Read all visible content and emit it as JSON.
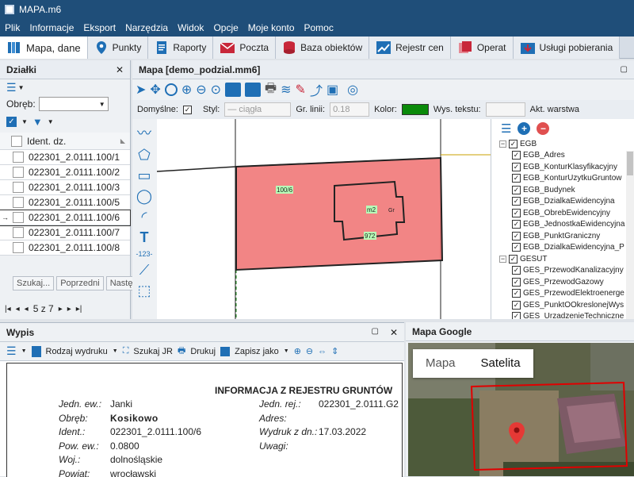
{
  "window": {
    "title": "MAPA.m6"
  },
  "menu": [
    "Plik",
    "Informacje",
    "Eksport",
    "Narzędzia",
    "Widok",
    "Opcje",
    "Moje konto",
    "Pomoc"
  ],
  "tabs": [
    {
      "label": "Mapa, dane",
      "icon": "map-book-icon",
      "color": "#1f6fb5"
    },
    {
      "label": "Punkty",
      "icon": "map-pin-icon",
      "color": "#1f6fb5"
    },
    {
      "label": "Raporty",
      "icon": "report-icon",
      "color": "#1f6fb5"
    },
    {
      "label": "Poczta",
      "icon": "envelope-icon",
      "color": "#c8273a"
    },
    {
      "label": "Baza obiektów",
      "icon": "database-icon",
      "color": "#c8273a"
    },
    {
      "label": "Rejestr cen",
      "icon": "chart-icon",
      "color": "#1f6fb5"
    },
    {
      "label": "Operat",
      "icon": "folders-icon",
      "color": "#c8273a"
    },
    {
      "label": "Usługi pobierania",
      "icon": "download-folder-icon",
      "color": "#1f6fb5"
    }
  ],
  "left": {
    "title": "Działki",
    "obreb_label": "Obręb:",
    "obreb_value": "",
    "column": "Ident. dz.",
    "rows": [
      "022301_2.0111.100/1",
      "022301_2.0111.100/2",
      "022301_2.0111.100/3",
      "022301_2.0111.100/5",
      "022301_2.0111.100/6",
      "022301_2.0111.100/7",
      "022301_2.0111.100/8"
    ],
    "selected_index": 4,
    "buttons": [
      "Szukaj...",
      "Poprzedni",
      "Następ"
    ],
    "pager": "5 z 7"
  },
  "map": {
    "title": "Mapa [demo_podzial.mm6]",
    "domyslne": "Domyślne:",
    "styl": "Styl:",
    "styl_value": "— ciągła",
    "gr_linii": "Gr. linii:",
    "gr_value": "0.18",
    "kolor": "Kolor:",
    "kolor_value": "#0a8a0a",
    "wys": "Wys. tekstu:",
    "akt": "Akt. warstwa",
    "parcel_label": "100/6",
    "building_label": "m2",
    "building_label2": "Gr",
    "building_id": "972"
  },
  "layers": [
    {
      "name": "EGB",
      "level": 0,
      "group": true
    },
    {
      "name": "EGB_Adres",
      "level": 1
    },
    {
      "name": "EGB_KonturKlasyfikacyjny",
      "level": 1
    },
    {
      "name": "EGB_KonturUzytkuGruntow",
      "level": 1
    },
    {
      "name": "EGB_Budynek",
      "level": 1
    },
    {
      "name": "EGB_DzialkaEwidencyjna",
      "level": 1
    },
    {
      "name": "EGB_ObrebEwidencyjny",
      "level": 1
    },
    {
      "name": "EGB_JednostkaEwidencyjna",
      "level": 1
    },
    {
      "name": "EGB_PunktGraniczny",
      "level": 1
    },
    {
      "name": "EGB_DzialkaEwidencyjna_P",
      "level": 1
    },
    {
      "name": "GESUT",
      "level": 0,
      "group": true
    },
    {
      "name": "GES_PrzewodKanalizacyjny",
      "level": 1
    },
    {
      "name": "GES_PrzewodGazowy",
      "level": 1
    },
    {
      "name": "GES_PrzewodElektroenerge",
      "level": 1
    },
    {
      "name": "GES_PunktOOkreslonejWys",
      "level": 1
    },
    {
      "name": "GES_UrzadzenieTechniczne",
      "level": 1
    }
  ],
  "wypis": {
    "title": "Wypis",
    "toolbar": [
      "Rodzaj wydruku",
      "Szukaj JR",
      "Drukuj",
      "Zapisz jako"
    ],
    "doc_title": "INFORMACJA Z REJESTRU GRUNTÓW",
    "left_fields": [
      {
        "k": "Jedn. ew.:",
        "v": "Janki"
      },
      {
        "k": "Obręb:",
        "v": "Kosikowo"
      },
      {
        "k": "Ident.:",
        "v": "022301_2.0111.100/6"
      },
      {
        "k": "Pow. ew.:",
        "v": "0.0800"
      },
      {
        "k": "Woj.:",
        "v": "dolnośląskie"
      },
      {
        "k": "Powiat:",
        "v": "wrocławski"
      }
    ],
    "right_fields": [
      {
        "k": "Jedn. rej.:",
        "v": "022301_2.0111.G2"
      },
      {
        "k": "Adres:",
        "v": ""
      },
      {
        "k": "Wydruk z dn.:",
        "v": "17.03.2022"
      },
      {
        "k": "Uwagi:",
        "v": ""
      }
    ]
  },
  "google": {
    "title": "Mapa Google",
    "map_btn": "Mapa",
    "sat_btn": "Satelita"
  }
}
